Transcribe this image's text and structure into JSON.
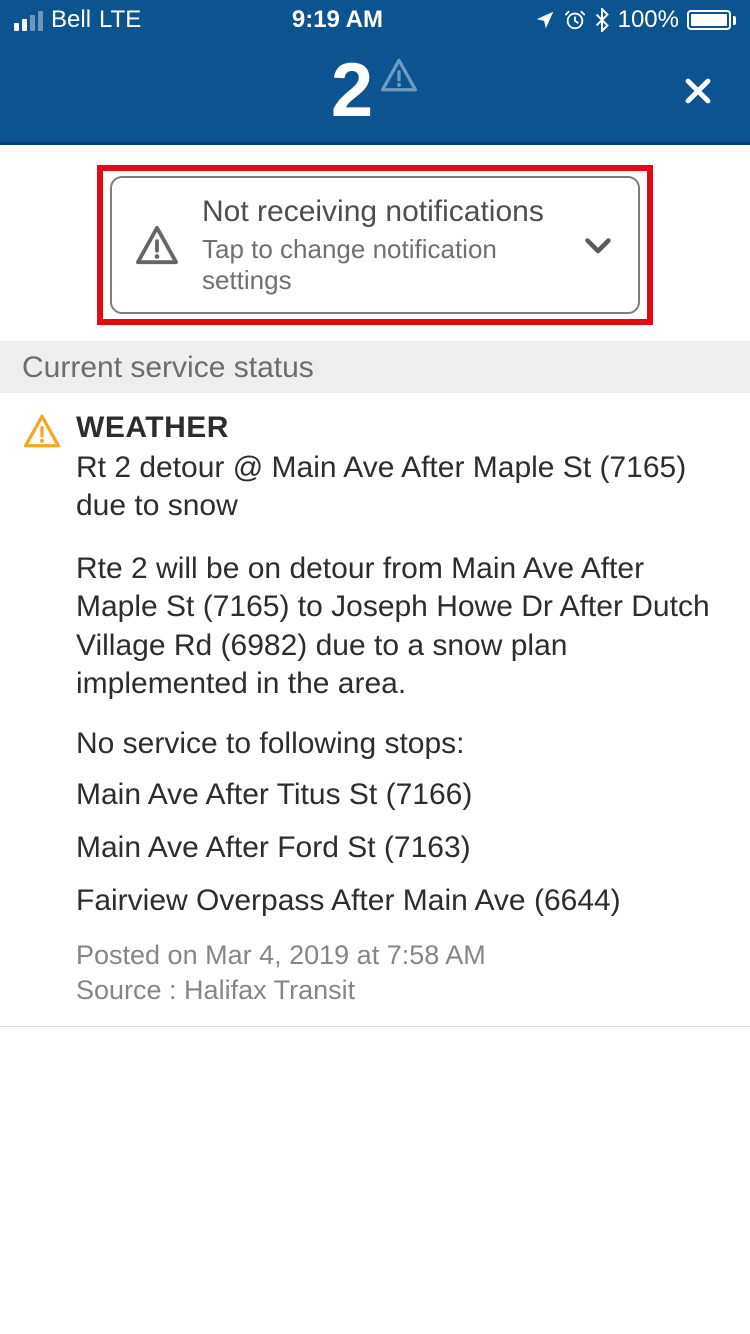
{
  "status_bar": {
    "carrier": "Bell",
    "network": "LTE",
    "time": "9:19 AM",
    "battery_pct": "100%"
  },
  "header": {
    "route_number": "2"
  },
  "notification_banner": {
    "title": "Not receiving notifications",
    "subtitle": "Tap to change notification settings"
  },
  "section_header": "Current service status",
  "alert": {
    "category": "WEATHER",
    "title": "Rt 2 detour @ Main Ave After Maple St (7165) due to snow",
    "description": "Rte 2 will be on detour from Main Ave After Maple St (7165) to Joseph Howe Dr After Dutch Village Rd (6982) due to a snow plan implemented in the area.",
    "no_service_intro": "No service to following stops:",
    "stops": [
      "Main Ave After Titus St (7166)",
      "Main Ave After Ford St (7163)",
      "Fairview Overpass After Main Ave (6644)"
    ],
    "posted": "Posted on Mar 4, 2019 at 7:58 AM",
    "source": "Source : Halifax Transit"
  }
}
